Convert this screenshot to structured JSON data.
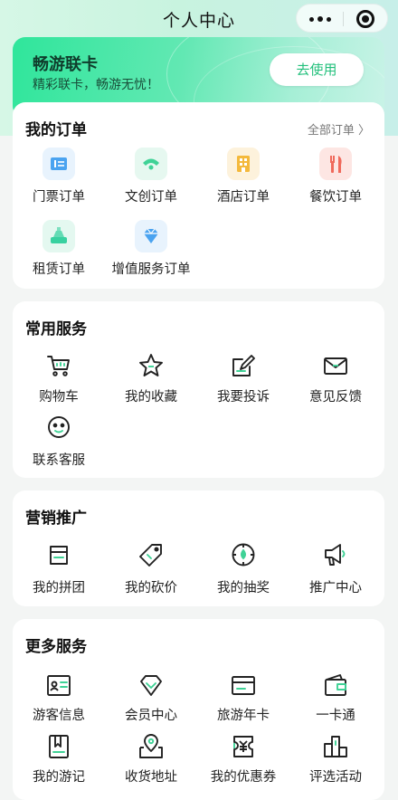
{
  "nav": {
    "title": "个人中心"
  },
  "banner": {
    "title": "畅游联卡",
    "subtitle": "精彩联卡，畅游无忧！",
    "button": "去使用"
  },
  "orders": {
    "title": "我的订单",
    "all_link": "全部订单 〉",
    "items": [
      {
        "label": "门票订单",
        "icon": "ticket-icon",
        "color": "#4aa3f0"
      },
      {
        "label": "文创订单",
        "icon": "fan-icon",
        "color": "#3fd296"
      },
      {
        "label": "酒店订单",
        "icon": "hotel-icon",
        "color": "#f4b93c"
      },
      {
        "label": "餐饮订单",
        "icon": "utensils-icon",
        "color": "#f06a5c"
      },
      {
        "label": "租赁订单",
        "icon": "rental-icon",
        "color": "#38d1a0"
      },
      {
        "label": "增值服务订单",
        "icon": "diamond-icon",
        "color": "#4aa3f0"
      }
    ]
  },
  "common": {
    "title": "常用服务",
    "items": [
      {
        "label": "购物车",
        "icon": "cart-icon"
      },
      {
        "label": "我的收藏",
        "icon": "star-icon"
      },
      {
        "label": "我要投诉",
        "icon": "edit-icon"
      },
      {
        "label": "意见反馈",
        "icon": "mail-icon"
      },
      {
        "label": "联系客服",
        "icon": "service-face-icon"
      }
    ]
  },
  "marketing": {
    "title": "营销推广",
    "items": [
      {
        "label": "我的拼团",
        "icon": "group-bag-icon"
      },
      {
        "label": "我的砍价",
        "icon": "price-tag-icon"
      },
      {
        "label": "我的抽奖",
        "icon": "lottery-icon"
      },
      {
        "label": "推广中心",
        "icon": "megaphone-icon"
      }
    ]
  },
  "more": {
    "title": "更多服务",
    "items": [
      {
        "label": "游客信息",
        "icon": "id-card-icon"
      },
      {
        "label": "会员中心",
        "icon": "vip-diamond-icon"
      },
      {
        "label": "旅游年卡",
        "icon": "card-icon"
      },
      {
        "label": "一卡通",
        "icon": "wallet-icon"
      },
      {
        "label": "我的游记",
        "icon": "book-icon"
      },
      {
        "label": "收货地址",
        "icon": "map-pin-icon"
      },
      {
        "label": "我的优惠券",
        "icon": "coupon-icon"
      },
      {
        "label": "评选活动",
        "icon": "ranking-icon"
      }
    ]
  }
}
